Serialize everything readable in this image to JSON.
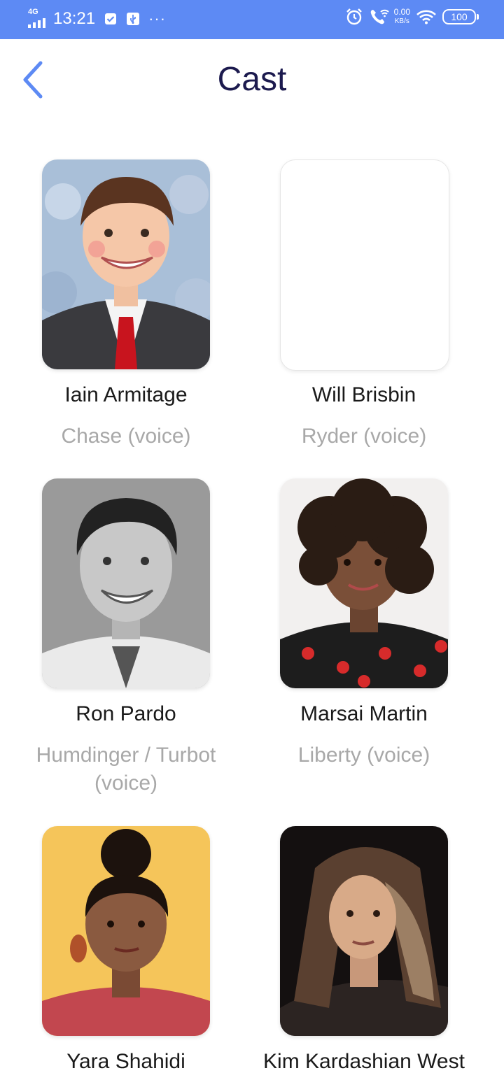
{
  "status_bar": {
    "network": "4G",
    "time": "13:21",
    "more": "···",
    "speed_value": "0.00",
    "speed_unit": "KB/s",
    "battery": "100",
    "icons": [
      "signal-icon",
      "check-shield-icon",
      "usb-icon",
      "alarm-icon",
      "wifi-call-icon",
      "wifi-icon",
      "battery-icon"
    ]
  },
  "header": {
    "title": "Cast",
    "back_icon": "chevron-left-icon"
  },
  "cast": [
    {
      "name": "Iain Armitage",
      "role": "Chase (voice)",
      "photo": "iain-armitage-photo"
    },
    {
      "name": "Will Brisbin",
      "role": "Ryder (voice)",
      "photo": "empty"
    },
    {
      "name": "Ron Pardo",
      "role": "Humdinger / Turbot (voice)",
      "photo": "ron-pardo-photo"
    },
    {
      "name": "Marsai Martin",
      "role": "Liberty (voice)",
      "photo": "marsai-martin-photo"
    },
    {
      "name": "Yara Shahidi",
      "role": "",
      "photo": "yara-shahidi-photo"
    },
    {
      "name": "Kim Kardashian West",
      "role": "",
      "photo": "kim-kardashian-west-photo"
    }
  ],
  "colors": {
    "status_bar": "#5d8af4",
    "title": "#1c1a4e",
    "back": "#5d8af4",
    "role_text": "#a8a8a8"
  }
}
